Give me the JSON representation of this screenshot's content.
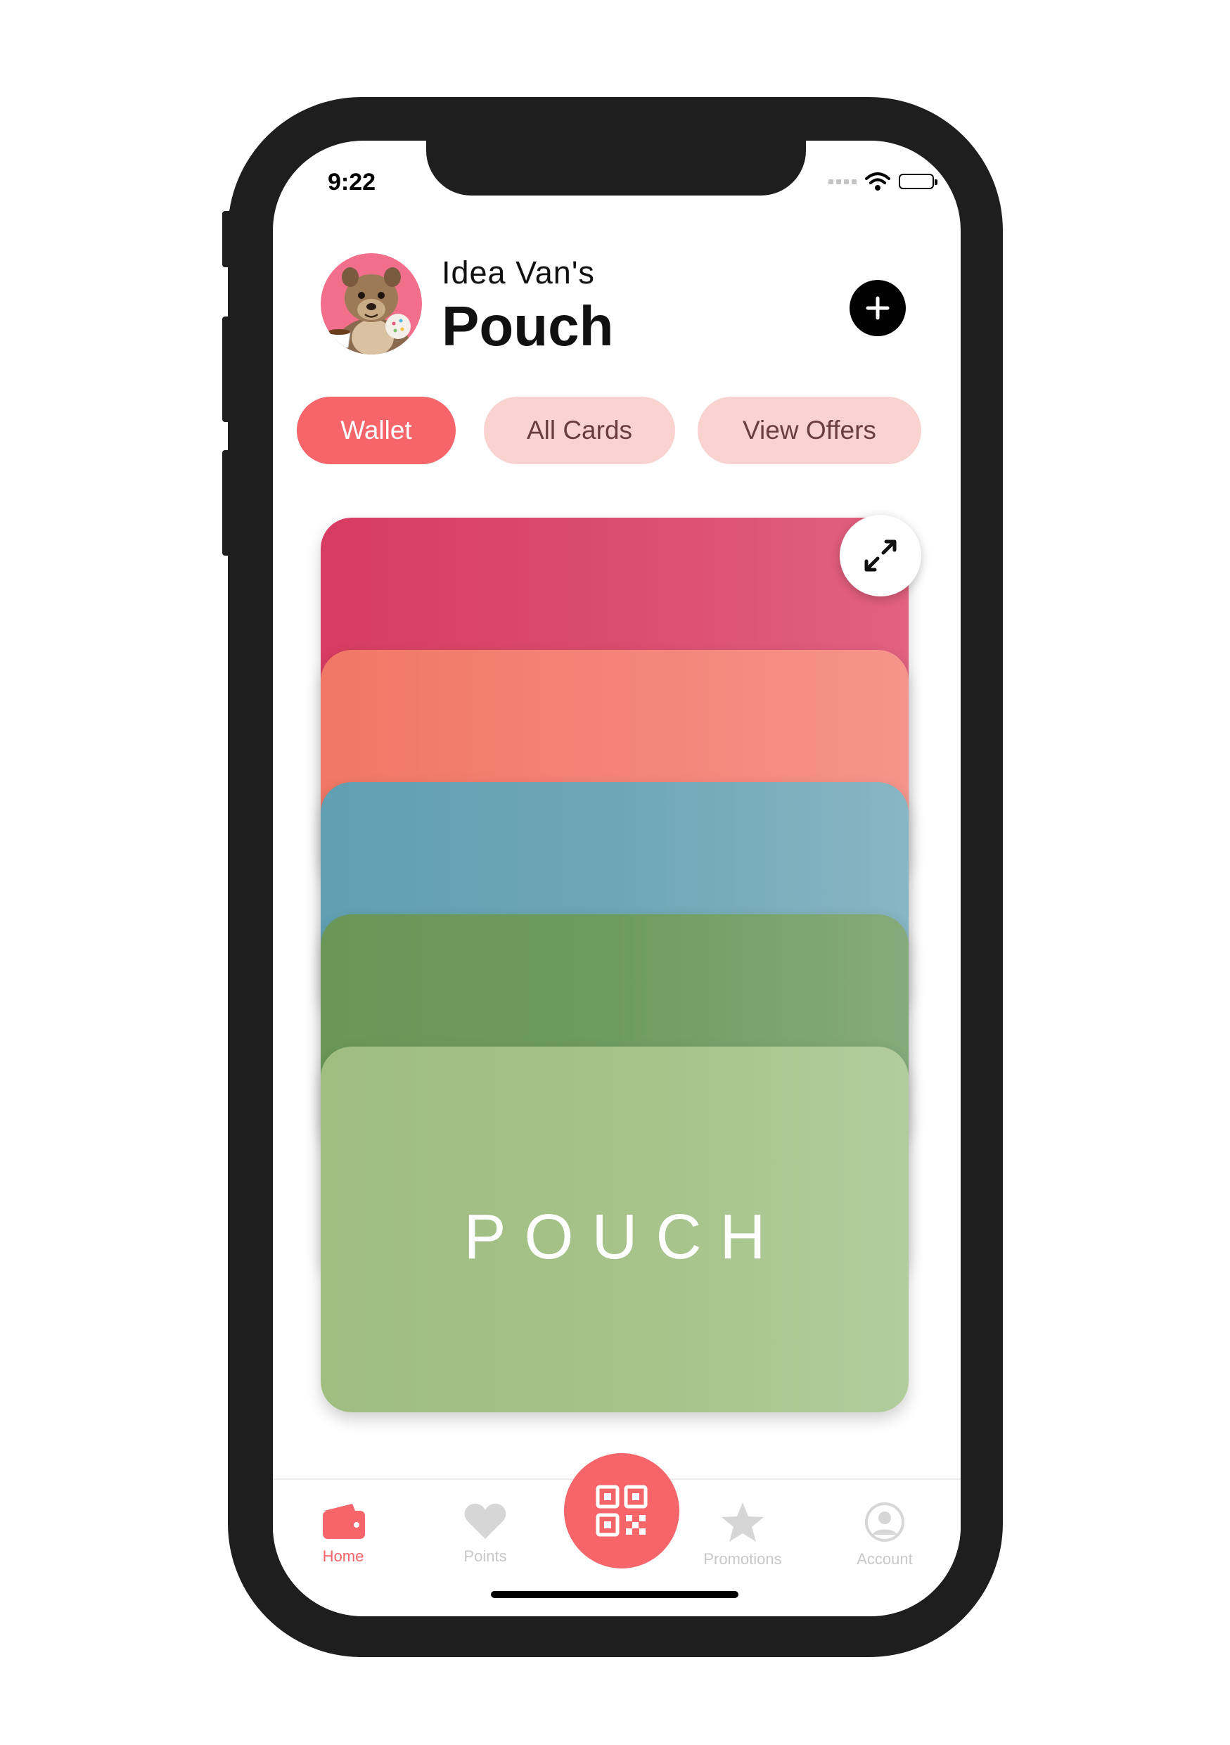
{
  "status_bar": {
    "time": "9:22"
  },
  "header": {
    "owner": "Idea Van's",
    "title": "Pouch"
  },
  "tabs": [
    {
      "label": "Wallet",
      "active": true
    },
    {
      "label": "All Cards",
      "active": false
    },
    {
      "label": "View Offers",
      "active": false
    }
  ],
  "cards": [
    {
      "color": "#d73c62"
    },
    {
      "color": "#f07765"
    },
    {
      "color": "#60a0b2"
    },
    {
      "color": "#6a9758"
    },
    {
      "color": "#9fbe80",
      "label": "POUCH"
    }
  ],
  "bottom_nav": {
    "items": [
      {
        "label": "Home",
        "icon": "wallet-icon",
        "active": true
      },
      {
        "label": "Points",
        "icon": "heart-icon",
        "active": false
      },
      {
        "label": "Promotions",
        "icon": "star-icon",
        "active": false
      },
      {
        "label": "Account",
        "icon": "user-circle-icon",
        "active": false
      }
    ],
    "center_icon": "qr-code-icon"
  },
  "colors": {
    "accent": "#f6656a",
    "tab_inactive_bg": "#f9d3cf",
    "inactive_icon": "#c8c8c8"
  }
}
